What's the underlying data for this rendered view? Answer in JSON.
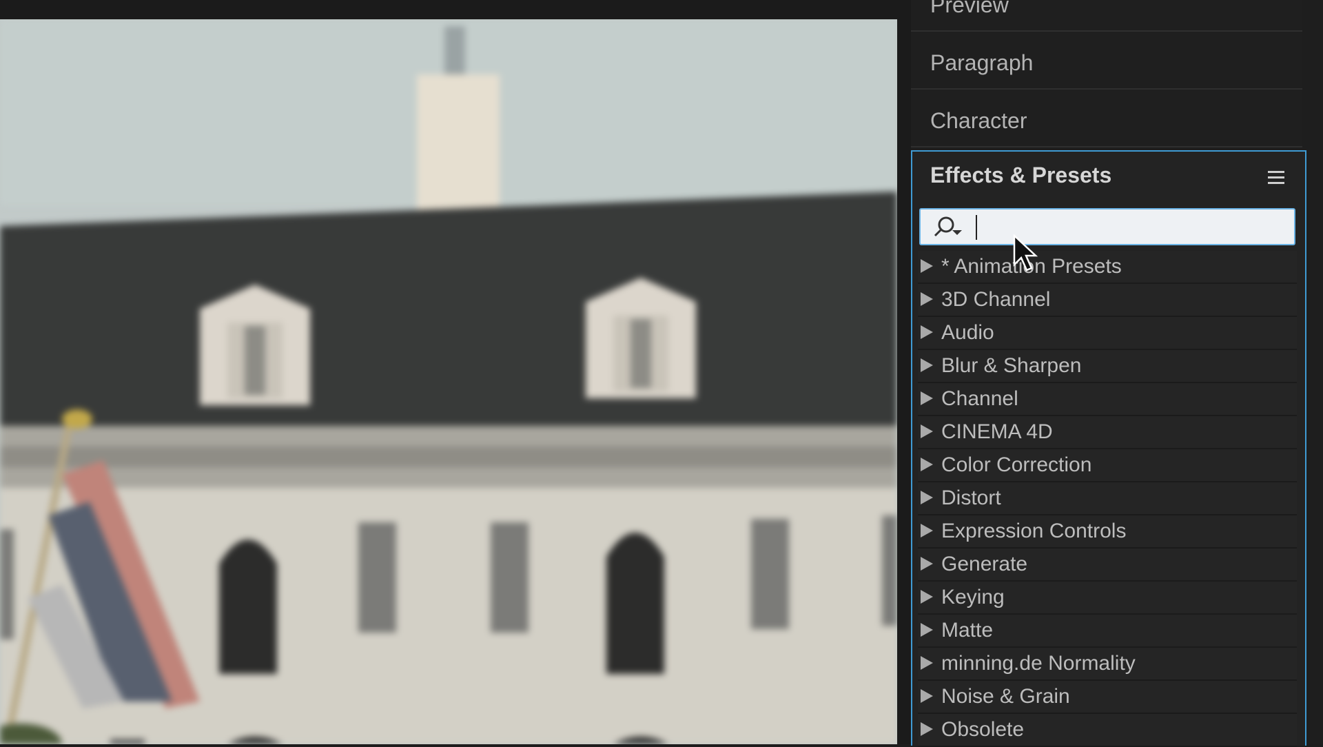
{
  "panel_tabs": {
    "preview": "Preview",
    "paragraph": "Paragraph",
    "character": "Character"
  },
  "effects_panel": {
    "title": "Effects & Presets",
    "search": {
      "value": "",
      "placeholder": ""
    },
    "categories": [
      "* Animation Presets",
      "3D Channel",
      "Audio",
      "Blur & Sharpen",
      "Channel",
      "CINEMA 4D",
      "Color Correction",
      "Distort",
      "Expression Controls",
      "Generate",
      "Keying",
      "Matte",
      "minning.de Normality",
      "Noise & Grain",
      "Obsolete"
    ]
  },
  "icons": {
    "menu": "hamburger-menu-icon",
    "search": "magnifier-dropdown-icon",
    "expand": "triangle-right-icon",
    "cursor": "mouse-pointer-icon"
  },
  "colors": {
    "panel_focus_border": "#3f9bd4",
    "search_field_bg": "#eef1f4",
    "panel_bg": "#232323",
    "text": "#bdbdbd"
  }
}
